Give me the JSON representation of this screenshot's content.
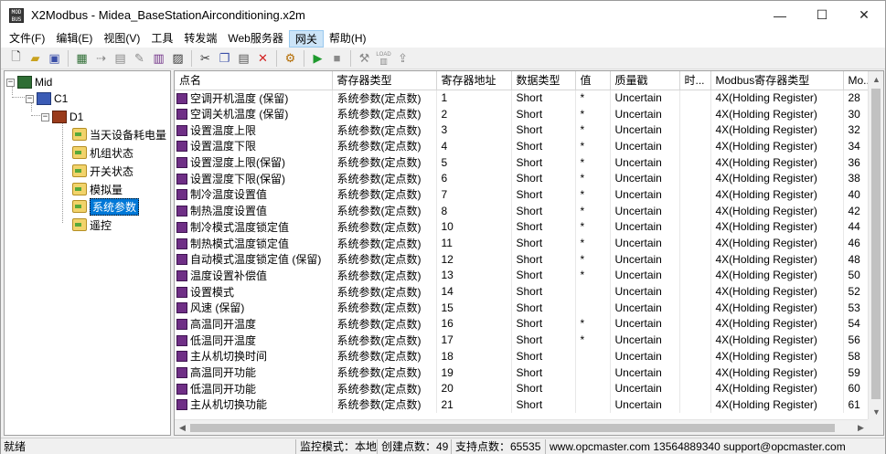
{
  "window": {
    "icon_text": "MOD BUS",
    "title": "X2Modbus - Midea_BaseStationAirconditioning.x2m",
    "controls": {
      "minimize": "—",
      "maximize": "☐",
      "close": "✕"
    }
  },
  "menu": [
    "文件(F)",
    "编辑(E)",
    "视图(V)",
    "工具",
    "转发端",
    "Web服务器",
    "网关",
    "帮助(H)"
  ],
  "menu_active_index": 6,
  "toolbar": {
    "icons": [
      "new-file-icon",
      "open-folder-icon",
      "save-icon",
      "add-channel-icon",
      "add-device-icon",
      "add-group-icon",
      "add-point-icon",
      "import-icon",
      "export-icon",
      "cut-icon",
      "copy-icon",
      "paste-icon",
      "delete-icon",
      "settings-icon",
      "run-icon",
      "stop-icon",
      "tools-icon",
      "load-icon",
      "upload-icon"
    ],
    "load_label": "LOAD"
  },
  "tree": {
    "root": "Mid",
    "channel": "C1",
    "device": "D1",
    "groups": [
      "当天设备耗电量",
      "机组状态",
      "开关状态",
      "模拟量",
      "系统参数",
      "遥控"
    ],
    "selected": "系统参数"
  },
  "table": {
    "columns": [
      "点名",
      "寄存器类型",
      "寄存器地址",
      "数据类型",
      "值",
      "质量戳",
      "时...",
      "Modbus寄存器类型",
      "Mo..."
    ],
    "rows": [
      [
        "空调开机温度 (保留)",
        "系统参数(定点数)",
        "1",
        "Short",
        "*",
        "Uncertain",
        "",
        "4X(Holding Register)",
        "28"
      ],
      [
        "空调关机温度 (保留)",
        "系统参数(定点数)",
        "2",
        "Short",
        "*",
        "Uncertain",
        "",
        "4X(Holding Register)",
        "30"
      ],
      [
        "设置温度上限",
        "系统参数(定点数)",
        "3",
        "Short",
        "*",
        "Uncertain",
        "",
        "4X(Holding Register)",
        "32"
      ],
      [
        "设置温度下限",
        "系统参数(定点数)",
        "4",
        "Short",
        "*",
        "Uncertain",
        "",
        "4X(Holding Register)",
        "34"
      ],
      [
        "设置湿度上限(保留)",
        "系统参数(定点数)",
        "5",
        "Short",
        "*",
        "Uncertain",
        "",
        "4X(Holding Register)",
        "36"
      ],
      [
        "设置湿度下限(保留)",
        "系统参数(定点数)",
        "6",
        "Short",
        "*",
        "Uncertain",
        "",
        "4X(Holding Register)",
        "38"
      ],
      [
        "制冷温度设置值",
        "系统参数(定点数)",
        "7",
        "Short",
        "*",
        "Uncertain",
        "",
        "4X(Holding Register)",
        "40"
      ],
      [
        "制热温度设置值",
        "系统参数(定点数)",
        "8",
        "Short",
        "*",
        "Uncertain",
        "",
        "4X(Holding Register)",
        "42"
      ],
      [
        "制冷模式温度锁定值",
        "系统参数(定点数)",
        "10",
        "Short",
        "*",
        "Uncertain",
        "",
        "4X(Holding Register)",
        "44"
      ],
      [
        "制热模式温度锁定值",
        "系统参数(定点数)",
        "11",
        "Short",
        "*",
        "Uncertain",
        "",
        "4X(Holding Register)",
        "46"
      ],
      [
        "自动模式温度锁定值 (保留)",
        "系统参数(定点数)",
        "12",
        "Short",
        "*",
        "Uncertain",
        "",
        "4X(Holding Register)",
        "48"
      ],
      [
        "温度设置补偿值",
        "系统参数(定点数)",
        "13",
        "Short",
        "*",
        "Uncertain",
        "",
        "4X(Holding Register)",
        "50"
      ],
      [
        "设置模式",
        "系统参数(定点数)",
        "14",
        "Short",
        "",
        "Uncertain",
        "",
        "4X(Holding Register)",
        "52"
      ],
      [
        "风速 (保留)",
        "系统参数(定点数)",
        "15",
        "Short",
        "",
        "Uncertain",
        "",
        "4X(Holding Register)",
        "53"
      ],
      [
        "高温同开温度",
        "系统参数(定点数)",
        "16",
        "Short",
        "*",
        "Uncertain",
        "",
        "4X(Holding Register)",
        "54"
      ],
      [
        "低温同开温度",
        "系统参数(定点数)",
        "17",
        "Short",
        "*",
        "Uncertain",
        "",
        "4X(Holding Register)",
        "56"
      ],
      [
        "主从机切换时间",
        "系统参数(定点数)",
        "18",
        "Short",
        "",
        "Uncertain",
        "",
        "4X(Holding Register)",
        "58"
      ],
      [
        "高温同开功能",
        "系统参数(定点数)",
        "19",
        "Short",
        "",
        "Uncertain",
        "",
        "4X(Holding Register)",
        "59"
      ],
      [
        "低温同开功能",
        "系统参数(定点数)",
        "20",
        "Short",
        "",
        "Uncertain",
        "",
        "4X(Holding Register)",
        "60"
      ],
      [
        "主从机切换功能",
        "系统参数(定点数)",
        "21",
        "Short",
        "",
        "Uncertain",
        "",
        "4X(Holding Register)",
        "61"
      ]
    ]
  },
  "statusbar": {
    "ready": "就绪",
    "mode": "监控模式：本地",
    "created": "创建点数：49",
    "supported": "支持点数：65535",
    "contact": "www.opcmaster.com 13564889340 support@opcmaster.com"
  }
}
